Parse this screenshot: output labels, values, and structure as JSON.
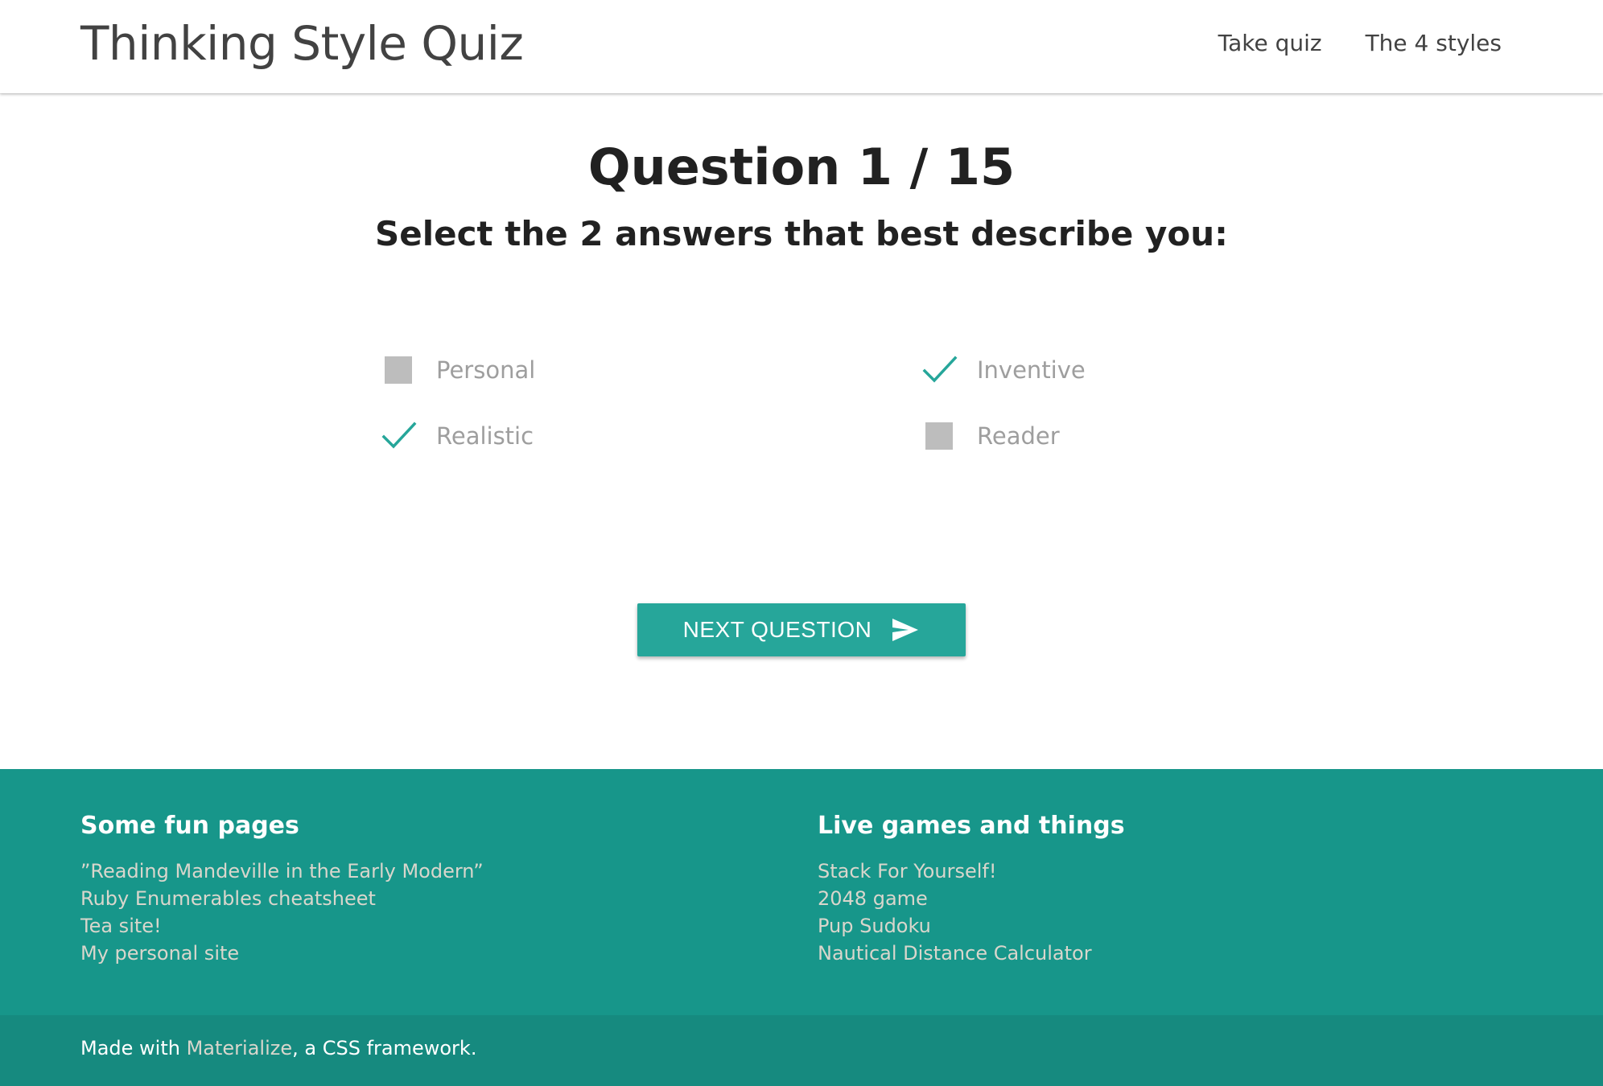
{
  "header": {
    "brand": "Thinking Style Quiz",
    "nav": [
      {
        "label": "Take quiz"
      },
      {
        "label": "The 4 styles"
      }
    ]
  },
  "quiz": {
    "title": "Question 1 / 15",
    "prompt": "Select the 2 answers that best describe you:",
    "options": [
      {
        "label": "Personal",
        "checked": false
      },
      {
        "label": "Inventive",
        "checked": true
      },
      {
        "label": "Realistic",
        "checked": true
      },
      {
        "label": "Reader",
        "checked": false
      }
    ],
    "next_label": "NEXT QUESTION",
    "next_icon": "send-icon"
  },
  "footer": {
    "col1": {
      "heading": "Some fun pages",
      "links": [
        "”Reading Mandeville in the Early Modern”",
        "Ruby Enumerables cheatsheet",
        "Tea site!",
        "My personal site"
      ]
    },
    "col2": {
      "heading": "Live games and things",
      "links": [
        "Stack For Yourself!",
        "2048 game",
        "Pup Sudoku",
        "Nautical Distance Calculator"
      ]
    },
    "copyright": {
      "prefix": "Made with ",
      "link": "Materialize",
      "suffix": ", a CSS framework."
    }
  },
  "colors": {
    "accent": "#26a69a",
    "footer_bg": "#17968a",
    "copyright_bg": "#168a7f",
    "unchecked_box": "#bdbdbd"
  }
}
